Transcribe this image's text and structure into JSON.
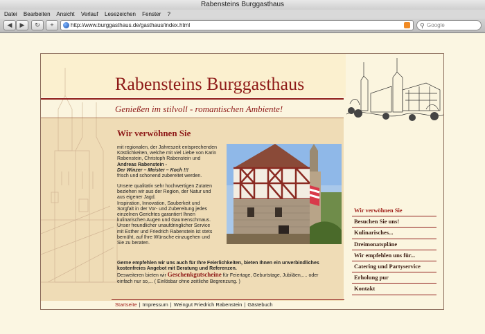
{
  "browser": {
    "window_title": "Rabensteins Burggasthaus",
    "menu": [
      "Datei",
      "Bearbeiten",
      "Ansicht",
      "Verlauf",
      "Lesezeichen",
      "Fenster",
      "?"
    ],
    "url": "http://www.burggasthaus.de/gasthaus/index.html",
    "search_placeholder": "Google"
  },
  "site": {
    "title": "Rabensteins Burggasthaus",
    "subtitle": "Genießen im stilvoll - romantischen Ambiente!"
  },
  "content": {
    "heading": "Wir verwöhnen Sie",
    "intro_lines": [
      "mit regionalen, der Jahreszeit entsprechenden",
      "Köstlichkeiten, welche mit viel Liebe von Karin",
      "Rabenstein, Christoph Rabenstein und"
    ],
    "chef_name": "Andreas Rabenstein -",
    "chef_tagline": "Der Winzer – Meister – Koch !!!",
    "prepared": " frisch und schonend zubereitet werden.",
    "quality_lines": [
      "Unsere qualitativ sehr hochwertigen Zutaten",
      "beziehen wir aus der Region, der Natur und",
      "aus eigener Jagd.",
      "Inspiration, Innovation, Sauberkeit und",
      "Sorgfalt  in der Vor- und Zubereitung jedes",
      "einzelnen Gerichtes garantiert Ihnen",
      "kulinarischen Augen und Gaumenschmaus.",
      "Unser freundlicher unaufdringlicher Service",
      "mit Esther und Friedrich Rabenstein ist stets",
      "bemüht, auf Ihre Wünsche einzugehen und",
      "Sie zu beraten."
    ],
    "events_bold_lines": [
      "Gerne empfehlen wir uns auch für Ihre Feierlichkeiten, bieten Ihnen ein unverbindliches",
      "kostenfreies Angebot mit Beratung und Referenzen."
    ],
    "voucher_prefix": "Desweiteren bieten wir ",
    "voucher_link": "Geschenkgutscheine",
    "voucher_suffix": " für Feiertage, Geburtstage, Jubiläen,.... oder",
    "voucher_line2": "einfach nur so,... ( Einlösbar ohne zeitliche Begrenzung. )"
  },
  "nav": [
    "Wir verwöhnen Sie",
    "Besuchen Sie uns!",
    "Kulinarisches...",
    "Dreimonatspläne",
    "Wir empfehlen uns für...",
    "Catering und Partyservice",
    "Erholung pur",
    "Kontakt"
  ],
  "footer": [
    "Startseite",
    "Impressum",
    "Weingut Friedrich Rabenstein",
    "Gästebuch"
  ],
  "colors": {
    "brand_red": "#8e1a18",
    "page_bg": "#fbf6e2",
    "content_bg": "#efdcb6"
  }
}
